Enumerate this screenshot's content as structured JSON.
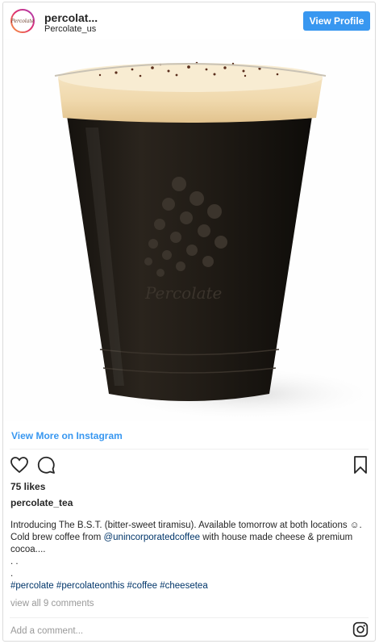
{
  "header": {
    "avatar_text": "Percolate",
    "username": "percolat...",
    "subname": "Percolate_us",
    "view_profile_label": "View Profile"
  },
  "media": {
    "cup_logo_text": "Percolate",
    "colors": {
      "foam": "#f1dcb5",
      "coffee": "#1e1913",
      "cocoa": "#5a2e1c"
    }
  },
  "links": {
    "view_more": "View More on Instagram"
  },
  "actions": {
    "icons": [
      "heart-icon",
      "comment-icon",
      "bookmark-icon"
    ]
  },
  "likes": "75 likes",
  "owner": "percolate_tea",
  "caption": {
    "line1": "Introducing The B.S.T. (bitter-sweet tiramisu). Available tomorrow at both locations ☺.",
    "line2_prefix": "Cold brew coffee from ",
    "mention": "@unincorporatedcoffee",
    "line2_suffix": " with house made cheese & premium",
    "line3": "cocoa....",
    "dots1": ". .",
    "dots2": ".",
    "hashtags": [
      "#percolate",
      "#percolateonthis",
      "#coffee",
      "#cheesetea"
    ]
  },
  "comments_link": "view all 9 comments",
  "add_comment_placeholder": "Add a comment...",
  "brand_color": "#3897f0"
}
